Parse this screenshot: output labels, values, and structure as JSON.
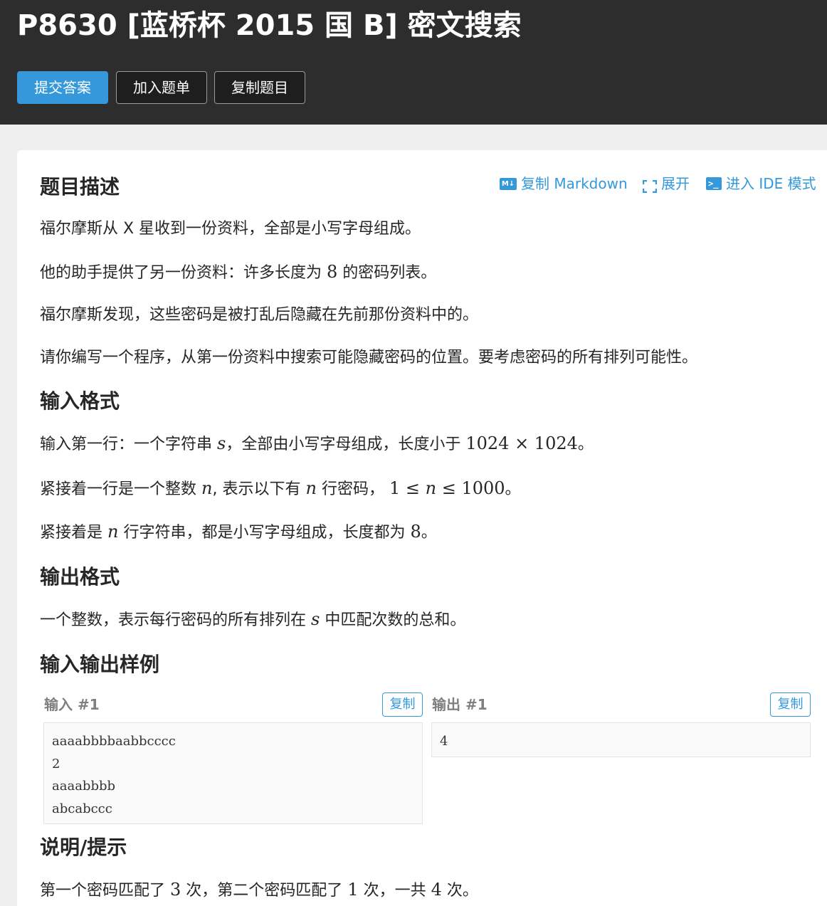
{
  "header": {
    "title": "P8630 [蓝桥杯 2015 国 B] 密文搜索",
    "buttons": {
      "submit": "提交答案",
      "add_list": "加入题单",
      "copy_problem": "复制题目"
    }
  },
  "toolbar": {
    "copy_markdown": "复制 Markdown",
    "expand": "展开",
    "ide_mode": "进入 IDE 模式"
  },
  "description": {
    "heading": "题目描述",
    "p1": "福尔摩斯从 X 星收到一份资料，全部是小写字母组成。",
    "p2_a": "他的助手提供了另一份资料：许多长度为",
    "p2_num": "8",
    "p2_b": "的密码列表。",
    "p3": "福尔摩斯发现，这些密码是被打乱后隐藏在先前那份资料中的。",
    "p4": "请你编写一个程序，从第一份资料中搜索可能隐藏密码的位置。要考虑密码的所有排列可能性。"
  },
  "input_format": {
    "heading": "输入格式",
    "l1_a": "输入第一行：一个字符串",
    "l1_var": "s",
    "l1_b": "，全部由小写字母组成，长度小于",
    "l1_math": "1024 × 1024",
    "l1_c": "。",
    "l2_a": "紧接着一行是一个整数",
    "l2_var": "n",
    "l2_b": ", 表示以下有",
    "l2_var2": "n",
    "l2_c": "行密码，",
    "l2_math": "1 ≤ ",
    "l2_var3": "n",
    "l2_math2": " ≤ 1000",
    "l2_d": "。",
    "l3_a": "紧接着是",
    "l3_var": "n",
    "l3_b": "行字符串，都是小写字母组成，长度都为",
    "l3_num": "8",
    "l3_c": "。"
  },
  "output_format": {
    "heading": "输出格式",
    "l1_a": "一个整数，表示每行密码的所有排列在",
    "l1_var": "s",
    "l1_b": "中匹配次数的总和。"
  },
  "samples": {
    "heading": "输入输出样例",
    "input_label": "输入 #1",
    "output_label": "输出 #1",
    "copy_label": "复制",
    "input_lines": [
      "aaaabbbbaabbcccc",
      "2",
      "aaaabbbb",
      "abcabccc"
    ],
    "output_lines": [
      "4"
    ]
  },
  "hint": {
    "heading": "说明/提示",
    "l1_a": "第一个密码匹配了",
    "l1_n1": "3",
    "l1_b": "次，第二个密码匹配了",
    "l1_n2": "1",
    "l1_c": "次，一共",
    "l1_n3": "4",
    "l1_d": "次。"
  },
  "colors": {
    "header_bg": "#2d2d2d",
    "primary": "#3498db",
    "page_bg": "#efefef"
  }
}
